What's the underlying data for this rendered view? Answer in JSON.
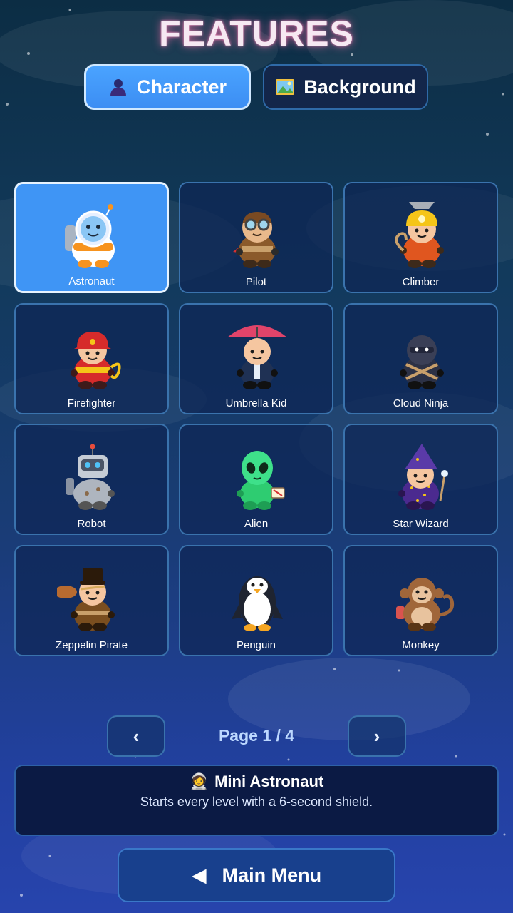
{
  "title": "FEATURES",
  "tabs": [
    {
      "label": "Character",
      "icon": "person-icon",
      "active": true
    },
    {
      "label": "Background",
      "icon": "picture-icon",
      "active": false
    }
  ],
  "characters": [
    {
      "name": "Astronaut",
      "icon": "astronaut",
      "selected": true
    },
    {
      "name": "Pilot",
      "icon": "pilot"
    },
    {
      "name": "Climber",
      "icon": "climber"
    },
    {
      "name": "Firefighter",
      "icon": "firefighter"
    },
    {
      "name": "Umbrella Kid",
      "icon": "umbrella-kid"
    },
    {
      "name": "Cloud Ninja",
      "icon": "ninja"
    },
    {
      "name": "Robot",
      "icon": "robot"
    },
    {
      "name": "Alien",
      "icon": "alien"
    },
    {
      "name": "Star Wizard",
      "icon": "wizard"
    },
    {
      "name": "Zeppelin Pirate",
      "icon": "pirate"
    },
    {
      "name": "Penguin",
      "icon": "penguin"
    },
    {
      "name": "Monkey",
      "icon": "monkey"
    }
  ],
  "pager": {
    "prev": "‹",
    "next": "›",
    "label": "Page 1 / 4"
  },
  "info": {
    "emoji": "🧑‍🚀",
    "title": "Mini Astronaut",
    "description": "Starts every level with a 6-second shield."
  },
  "menu": {
    "icon": "◀",
    "label": "Main Menu"
  },
  "colors": {
    "accent": "#4aa3ff",
    "title_glow": "#ff6eaa",
    "card_border": "#3a73ad"
  }
}
